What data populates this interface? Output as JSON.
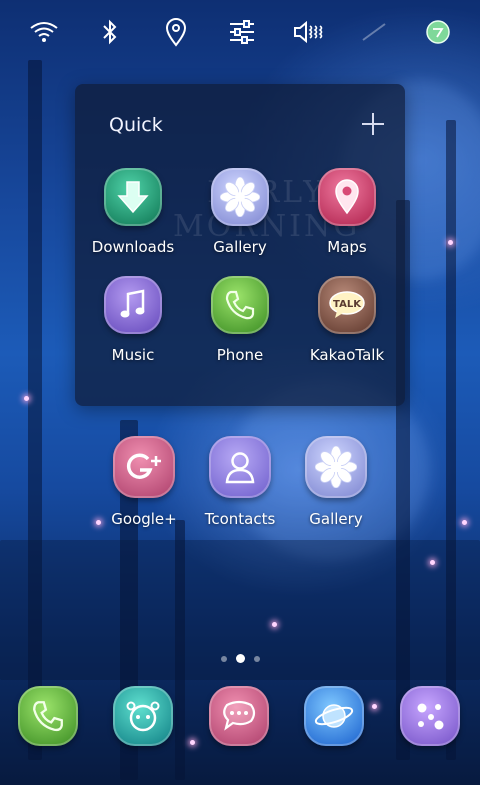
{
  "status_icons": [
    "wifi-icon",
    "bluetooth-icon",
    "location-icon",
    "sliders-icon",
    "vibrate-icon",
    "wand-icon",
    "clock-icon"
  ],
  "folder": {
    "title": "Quick",
    "add_icon": "plus-icon",
    "watermark_line1": "EARLY",
    "watermark_line2": "MORNING",
    "apps": [
      {
        "label": "Downloads",
        "icon": "download-arrow-icon",
        "color": "#2fb38a"
      },
      {
        "label": "Gallery",
        "icon": "flower-icon",
        "color": "#a9b2f0"
      },
      {
        "label": "Maps",
        "icon": "map-pin-icon",
        "color": "#d84a76"
      },
      {
        "label": "Music",
        "icon": "music-note-icon",
        "color": "#8c72d8"
      },
      {
        "label": "Phone",
        "icon": "phone-icon",
        "color": "#6bbf46"
      },
      {
        "label": "KakaoTalk",
        "icon": "talk-bubble-icon",
        "color": "#8a5a4c"
      }
    ]
  },
  "home_apps": [
    {
      "label": "Google+",
      "icon": "google-plus-icon",
      "color": "#d45a85"
    },
    {
      "label": "Tcontacts",
      "icon": "person-icon",
      "color": "#9888e2"
    },
    {
      "label": "Gallery",
      "icon": "flower-icon",
      "color": "#9b8ef0"
    }
  ],
  "pager": {
    "pages": 3,
    "active": 2
  },
  "dock": [
    {
      "icon": "phone-icon",
      "color": "#6bbf46"
    },
    {
      "icon": "alien-face-icon",
      "color": "#2fb3a8"
    },
    {
      "icon": "chat-bubble-icon",
      "color": "#d45a85"
    },
    {
      "icon": "planet-icon",
      "color": "#3f8fe8"
    },
    {
      "icon": "apps-grid-icon",
      "color": "#9b7ae0"
    }
  ]
}
